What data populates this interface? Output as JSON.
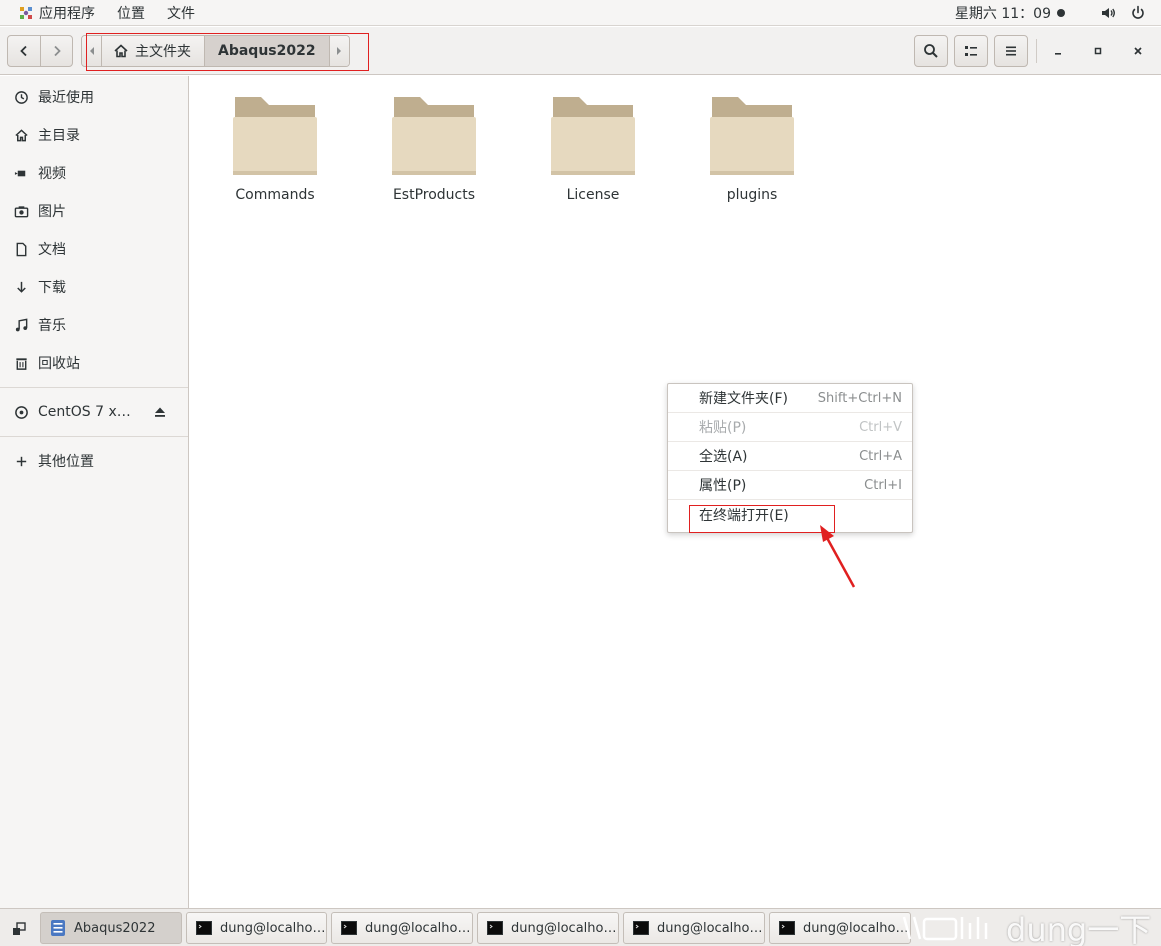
{
  "topbar": {
    "applications": "应用程序",
    "places": "位置",
    "app_menu": "文件",
    "clock": "星期六 11：09"
  },
  "header": {
    "breadcrumb": {
      "home": "主文件夹",
      "current": "Abaqus2022"
    }
  },
  "sidebar": {
    "items": [
      {
        "label": "最近使用",
        "icon": "clock-icon"
      },
      {
        "label": "主目录",
        "icon": "home-icon"
      },
      {
        "label": "视频",
        "icon": "video-icon"
      },
      {
        "label": "图片",
        "icon": "camera-icon"
      },
      {
        "label": "文档",
        "icon": "document-icon"
      },
      {
        "label": "下载",
        "icon": "download-icon"
      },
      {
        "label": "音乐",
        "icon": "music-icon"
      },
      {
        "label": "回收站",
        "icon": "trash-icon"
      }
    ],
    "device": {
      "label": "CentOS 7 x…",
      "icon": "disc-icon"
    },
    "other": {
      "label": "其他位置",
      "icon": "plus-icon"
    }
  },
  "files": [
    {
      "name": "Commands"
    },
    {
      "name": "EstProducts"
    },
    {
      "name": "License"
    },
    {
      "name": "plugins"
    }
  ],
  "context_menu": {
    "items": [
      {
        "label": "新建文件夹(F)",
        "accel": "Shift+Ctrl+N",
        "disabled": false
      },
      {
        "label": "粘贴(P)",
        "accel": "Ctrl+V",
        "disabled": true
      },
      {
        "label": "全选(A)",
        "accel": "Ctrl+A",
        "disabled": false
      },
      {
        "label": "属性(P)",
        "accel": "Ctrl+I",
        "disabled": false
      },
      {
        "label": "在终端打开(E)",
        "accel": "",
        "disabled": false
      }
    ]
  },
  "taskbar": {
    "items": [
      {
        "label": "Abaqus2022",
        "active": true
      },
      {
        "label": "dung@localho…",
        "active": false
      },
      {
        "label": "dung@localho…",
        "active": false
      },
      {
        "label": "dung@localho…",
        "active": false
      },
      {
        "label": "dung@localho…",
        "active": false
      },
      {
        "label": "dung@localho…",
        "active": false
      }
    ],
    "watermark": "dung一下"
  },
  "colors": {
    "annotation": "#e02020",
    "folder": "#dccfb4"
  }
}
